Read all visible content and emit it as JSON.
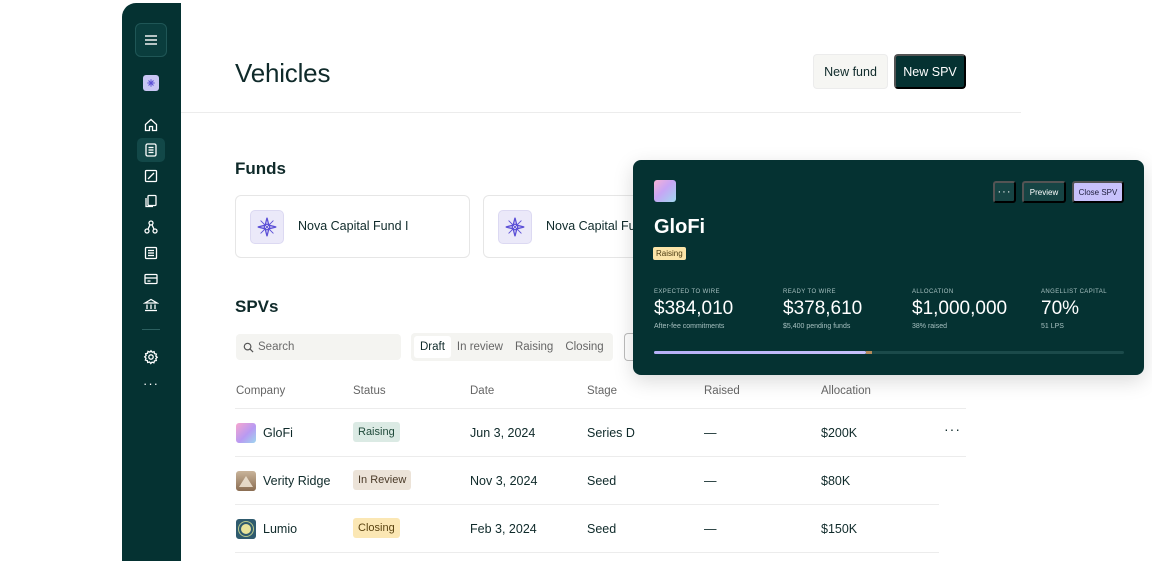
{
  "header": {
    "title": "Vehicles",
    "new_fund_label": "New fund",
    "new_spv_label": "New SPV"
  },
  "sidebar": {
    "items": [
      {
        "icon": "home-icon",
        "active": false
      },
      {
        "icon": "document-stack-icon",
        "active": true
      },
      {
        "icon": "note-icon",
        "active": false
      },
      {
        "icon": "files-icon",
        "active": false
      },
      {
        "icon": "network-icon",
        "active": false
      },
      {
        "icon": "list-icon",
        "active": false
      },
      {
        "icon": "card-icon",
        "active": false
      },
      {
        "icon": "bank-icon",
        "active": false
      }
    ],
    "settings_icon": "gear-icon",
    "more_label": "···"
  },
  "funds": {
    "title": "Funds",
    "items": [
      {
        "name": "Nova Capital Fund I"
      },
      {
        "name": "Nova Capital Fu"
      }
    ]
  },
  "spvs": {
    "title": "SPVs",
    "search_placeholder": "Search",
    "tabs": [
      {
        "label": "Draft",
        "active": true
      },
      {
        "label": "In review",
        "active": false
      },
      {
        "label": "Raising",
        "active": false
      },
      {
        "label": "Closing",
        "active": false
      }
    ],
    "columns": [
      "Company",
      "Status",
      "Date",
      "Stage",
      "Raised",
      "Allocation"
    ],
    "rows": [
      {
        "company": "GloFi",
        "status": "Raising",
        "date": "Jun 3, 2024",
        "stage": "Series D",
        "raised": "—",
        "allocation": "$200K",
        "more": "···"
      },
      {
        "company": "Verity Ridge",
        "status": "In Review",
        "date": "Nov 3, 2024",
        "stage": "Seed",
        "raised": "—",
        "allocation": "$80K",
        "more": ""
      },
      {
        "company": "Lumio",
        "status": "Closing",
        "date": "Feb 3, 2024",
        "stage": "Seed",
        "raised": "—",
        "allocation": "$150K",
        "more": ""
      }
    ]
  },
  "panel": {
    "title": "GloFi",
    "badge": "Raising",
    "more_label": "···",
    "preview_label": "Preview",
    "close_label": "Close SPV",
    "stats": [
      {
        "label": "EXPECTED TO WIRE",
        "value": "$384,010",
        "sub": "After-fee commitments"
      },
      {
        "label": "READY TO WIRE",
        "value": "$378,610",
        "sub": "$5,400 pending funds"
      },
      {
        "label": "ALLOCATION",
        "value": "$1,000,000",
        "sub": "38% raised"
      },
      {
        "label": "ANGELLIST CAPITAL",
        "value": "70%",
        "sub": "51 LPS"
      }
    ],
    "progress_fraction": 0.45
  },
  "colors": {
    "sidebar_bg": "#053232",
    "primary": "#053232",
    "accent": "#c7c1fb",
    "badge_raising": "#dbeae4",
    "badge_review": "#ece3d8",
    "badge_closing": "#fbe7b4"
  }
}
